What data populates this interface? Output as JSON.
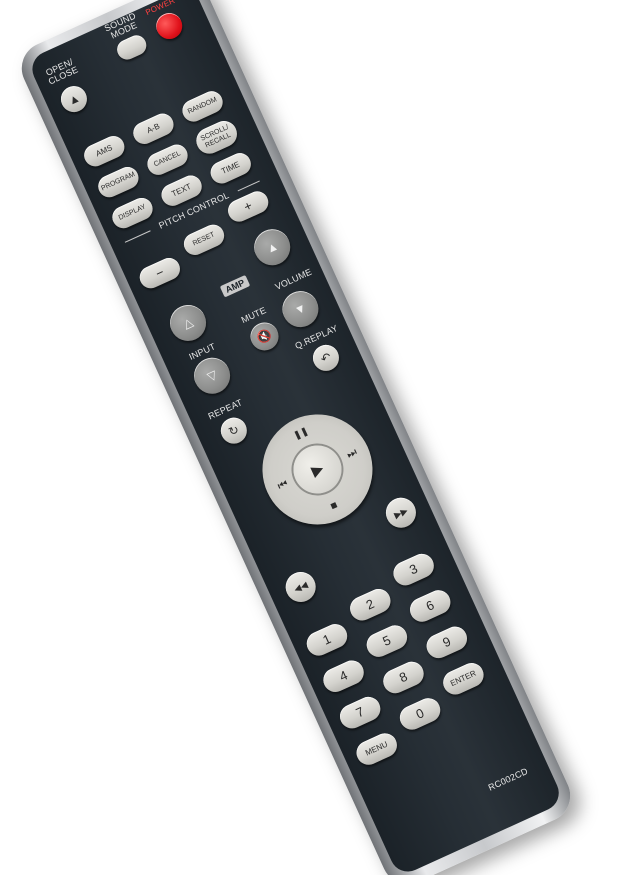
{
  "colors": {
    "body": "#262e35",
    "button": "#d8d7d2",
    "power": "#e0121b",
    "trim": "#c7c9cc"
  },
  "remote": {
    "model": "RC002CD",
    "labels": {
      "open_close": "OPEN/\nCLOSE",
      "sound_mode": "SOUND\nMODE",
      "power": "POWER",
      "pitch_control": "PITCH CONTROL",
      "amp": "AMP",
      "input": "INPUT",
      "mute": "MUTE",
      "volume": "VOLUME",
      "q_replay": "Q.REPLAY",
      "repeat": "REPEAT"
    },
    "buttons": {
      "ams": "AMS",
      "ab": "A-B",
      "random": "RANDOM",
      "program": "PROGRAM",
      "cancel": "CANCEL",
      "scroll_recall": "SCROLL/\nRECALL",
      "display": "DISPLAY",
      "text": "TEXT",
      "time": "TIME",
      "plus": "+",
      "reset": "RESET",
      "minus": "−",
      "n1": "1",
      "n2": "2",
      "n3": "3",
      "n4": "4",
      "n5": "5",
      "n6": "6",
      "n7": "7",
      "n8": "8",
      "n9": "9",
      "n0": "0",
      "menu": "MENU",
      "enter": "ENTER"
    },
    "icons": {
      "eject": "▲",
      "up_triangle": "△",
      "down_triangle": "▽",
      "mute": "🔇",
      "replay": "↶",
      "repeat": "↻",
      "pause": "❚❚",
      "play": "▶",
      "stop": "■",
      "prev": "⏮",
      "next": "⏭",
      "rewind": "◀◀",
      "fast_forward": "▶▶",
      "vol_up": "▲",
      "vol_down": "▼"
    }
  }
}
